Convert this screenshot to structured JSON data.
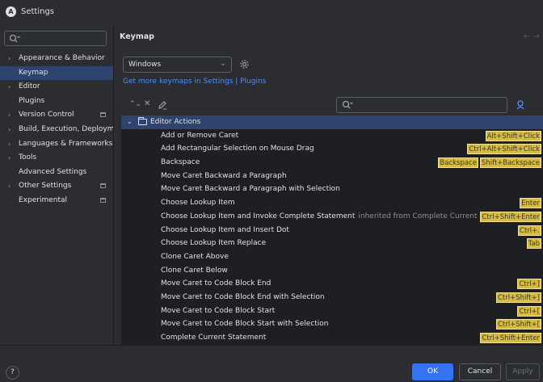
{
  "window": {
    "title": "Settings",
    "app_icon_letter": "A"
  },
  "sidebar": {
    "search_placeholder": "",
    "items": [
      {
        "label": "Appearance & Behavior",
        "expandable": true,
        "project": false
      },
      {
        "label": "Keymap",
        "expandable": false,
        "project": false,
        "selected": true
      },
      {
        "label": "Editor",
        "expandable": true,
        "project": false
      },
      {
        "label": "Plugins",
        "expandable": false,
        "project": false
      },
      {
        "label": "Version Control",
        "expandable": true,
        "project": true
      },
      {
        "label": "Build, Execution, Deployment",
        "expandable": true,
        "project": false
      },
      {
        "label": "Languages & Frameworks",
        "expandable": true,
        "project": false
      },
      {
        "label": "Tools",
        "expandable": true,
        "project": false
      },
      {
        "label": "Advanced Settings",
        "expandable": false,
        "project": false
      },
      {
        "label": "Other Settings",
        "expandable": true,
        "project": true
      },
      {
        "label": "Experimental",
        "expandable": false,
        "project": true
      }
    ]
  },
  "main": {
    "header": "Keymap",
    "nav_arrows": "← →",
    "keymap_select": {
      "value": "Windows"
    },
    "link": "Get more keymaps in Settings | Plugins",
    "action_search_placeholder": "",
    "group": {
      "label": "Editor Actions",
      "expanded": true
    },
    "actions": [
      {
        "label": "Add or Remove Caret",
        "inherited": "",
        "shortcuts": [
          "Alt+Shift+Click"
        ]
      },
      {
        "label": "Add Rectangular Selection on Mouse Drag",
        "inherited": "",
        "shortcuts": [
          "Ctrl+Alt+Shift+Click"
        ]
      },
      {
        "label": "Backspace",
        "inherited": "",
        "shortcuts": [
          "Backspace",
          "Shift+Backspace"
        ]
      },
      {
        "label": "Move Caret Backward a Paragraph",
        "inherited": "",
        "shortcuts": []
      },
      {
        "label": "Move Caret Backward a Paragraph with Selection",
        "inherited": "",
        "shortcuts": []
      },
      {
        "label": "Choose Lookup Item",
        "inherited": "",
        "shortcuts": [
          "Enter"
        ]
      },
      {
        "label": "Choose Lookup Item and Invoke Complete Statement",
        "inherited": "inherited from Complete Current Statement",
        "shortcuts": [
          "Ctrl+Shift+Enter"
        ]
      },
      {
        "label": "Choose Lookup Item and Insert Dot",
        "inherited": "",
        "shortcuts": [
          "Ctrl+."
        ]
      },
      {
        "label": "Choose Lookup Item Replace",
        "inherited": "",
        "shortcuts": [
          "Tab"
        ]
      },
      {
        "label": "Clone Caret Above",
        "inherited": "",
        "shortcuts": []
      },
      {
        "label": "Clone Caret Below",
        "inherited": "",
        "shortcuts": []
      },
      {
        "label": "Move Caret to Code Block End",
        "inherited": "",
        "shortcuts": [
          "Ctrl+]"
        ]
      },
      {
        "label": "Move Caret to Code Block End with Selection",
        "inherited": "",
        "shortcuts": [
          "Ctrl+Shift+]"
        ]
      },
      {
        "label": "Move Caret to Code Block Start",
        "inherited": "",
        "shortcuts": [
          "Ctrl+["
        ]
      },
      {
        "label": "Move Caret to Code Block Start with Selection",
        "inherited": "",
        "shortcuts": [
          "Ctrl+Shift+["
        ]
      },
      {
        "label": "Complete Current Statement",
        "inherited": "",
        "shortcuts": [
          "Ctrl+Shift+Enter"
        ]
      }
    ]
  },
  "footer": {
    "help": "?",
    "ok": "OK",
    "cancel": "Cancel",
    "apply": "Apply"
  },
  "colors": {
    "accent": "#3574f0",
    "selection": "#2e436e",
    "shortcut_bg": "#d6bb47",
    "link": "#548af7"
  }
}
